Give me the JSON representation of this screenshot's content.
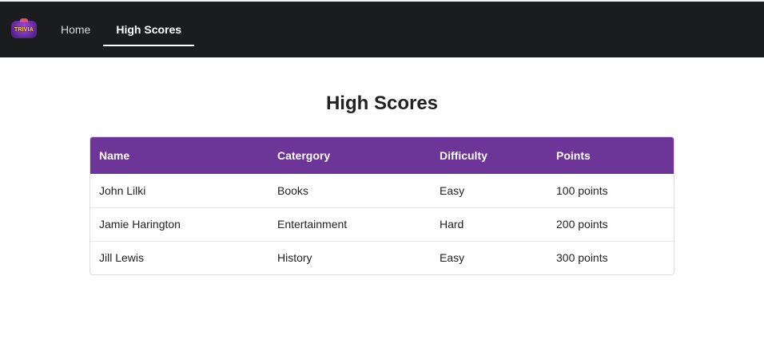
{
  "nav": {
    "logo_text": "TRIVIA",
    "items": [
      {
        "label": "Home",
        "active": false
      },
      {
        "label": "High Scores",
        "active": true
      }
    ]
  },
  "page": {
    "title": "High Scores"
  },
  "table": {
    "headers": [
      "Name",
      "Catergory",
      "Difficulty",
      "Points"
    ],
    "rows": [
      [
        "John Lilki",
        "Books",
        "Easy",
        "100 points"
      ],
      [
        "Jamie Harington",
        "Entertainment",
        "Hard",
        "200 points"
      ],
      [
        "Jill Lewis",
        "History",
        "Easy",
        "300 points"
      ]
    ]
  },
  "colors": {
    "navbar": "#1b1c1d",
    "table_header": "#6c3597"
  }
}
